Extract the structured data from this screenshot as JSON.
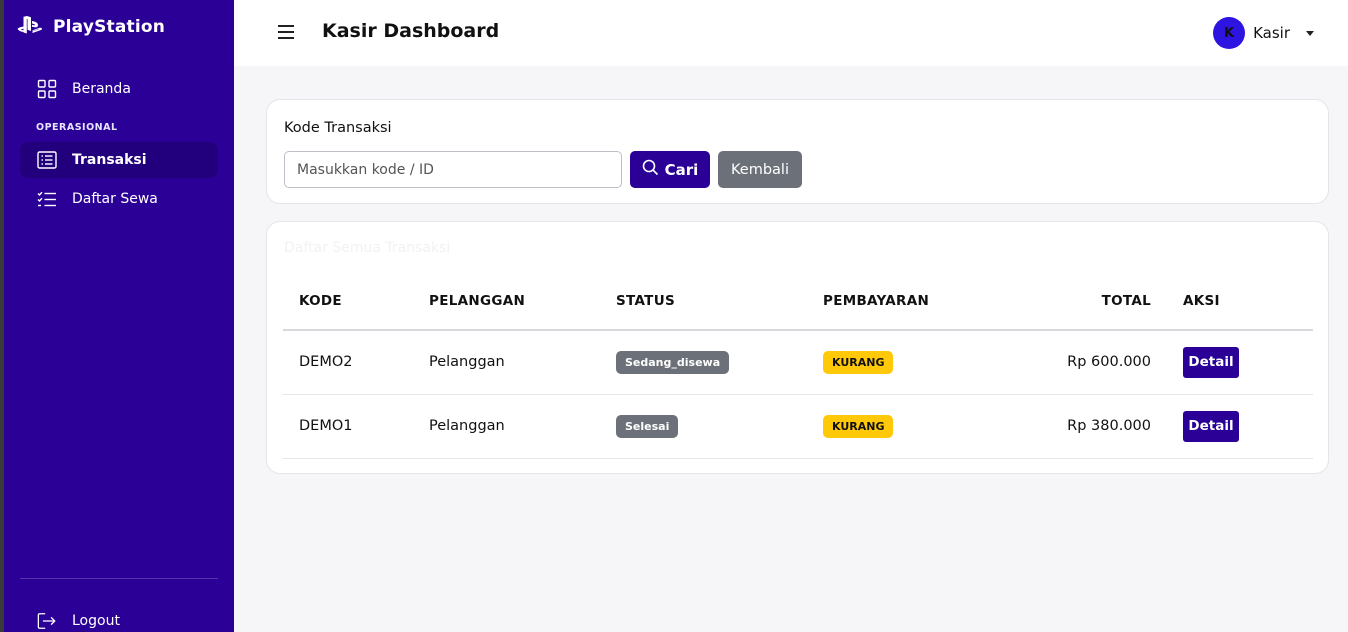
{
  "brand": {
    "name": "PlayStation"
  },
  "sidebar": {
    "items": [
      {
        "label": "Beranda",
        "icon": "grid-icon"
      },
      {
        "label": "Transaksi",
        "icon": "receipt-icon",
        "active": true
      },
      {
        "label": "Daftar Sewa",
        "icon": "list-check-icon"
      }
    ],
    "section_title": "OPERASIONAL",
    "logout_label": "Logout"
  },
  "header": {
    "title": "Kasir Dashboard",
    "user": {
      "initial": "K",
      "name": "Kasir"
    }
  },
  "search": {
    "label": "Kode Transaksi",
    "placeholder": "Masukkan kode / ID",
    "search_button": "Cari",
    "back_button": "Kembali"
  },
  "table": {
    "title": "Daftar Semua Transaksi",
    "columns": [
      "KODE",
      "PELANGGAN",
      "STATUS",
      "PEMBAYARAN",
      "TOTAL",
      "AKSI"
    ],
    "rows": [
      {
        "kode": "DEMO2",
        "pelanggan": "Pelanggan",
        "status": "Sedang_disewa",
        "pembayaran": "KURANG",
        "total": "Rp 600.000",
        "aksi": "Detail"
      },
      {
        "kode": "DEMO1",
        "pelanggan": "Pelanggan",
        "status": "Selesai",
        "pembayaran": "KURANG",
        "total": "Rp 380.000",
        "aksi": "Detail"
      }
    ]
  },
  "colors": {
    "primary": "#2a0097",
    "secondary": "#6c7179",
    "warning": "#ffc90a"
  }
}
